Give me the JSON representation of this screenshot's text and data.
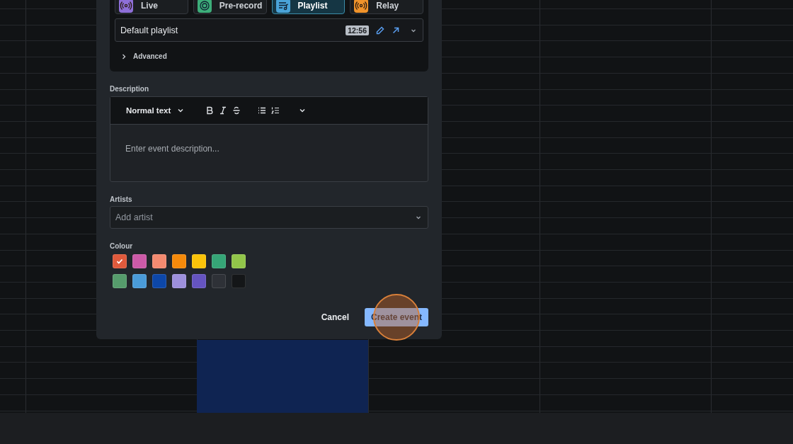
{
  "source_tabs": [
    {
      "label": "Live",
      "kind": "live",
      "color": "#8e6fd8",
      "selected": false
    },
    {
      "label": "Pre-record",
      "kind": "record",
      "color": "#3dae7a",
      "selected": false
    },
    {
      "label": "Playlist",
      "kind": "playlist",
      "color": "#4aa3d8",
      "selected": true
    },
    {
      "label": "Relay",
      "kind": "relay",
      "color": "#f0932b",
      "selected": false
    }
  ],
  "playlist": {
    "value": "Default playlist",
    "duration": "12:56"
  },
  "advanced": {
    "label": "Advanced",
    "expanded": false
  },
  "description": {
    "label": "Description",
    "format": "Normal text",
    "placeholder": "Enter event description..."
  },
  "artists": {
    "label": "Artists",
    "placeholder": "Add artist"
  },
  "colour": {
    "label": "Colour",
    "swatches": [
      {
        "color": "#e05a3c",
        "selected": true
      },
      {
        "color": "#cc5aa8",
        "selected": false
      },
      {
        "color": "#f38a70",
        "selected": false
      },
      {
        "color": "#f58a0b",
        "selected": false
      },
      {
        "color": "#fbc30a",
        "selected": false
      },
      {
        "color": "#36a577",
        "selected": false
      },
      {
        "color": "#92c54a",
        "selected": false
      },
      {
        "color": "#569c6c",
        "selected": false
      },
      {
        "color": "#4a9bd8",
        "selected": false
      },
      {
        "color": "#0d47a8",
        "selected": false
      },
      {
        "color": "#9d90dc",
        "selected": false
      },
      {
        "color": "#6554c0",
        "selected": false
      },
      {
        "color": "#2e3137",
        "selected": false
      },
      {
        "color": "#141618",
        "selected": false
      }
    ]
  },
  "buttons": {
    "cancel": "Cancel",
    "create": "Create event"
  }
}
